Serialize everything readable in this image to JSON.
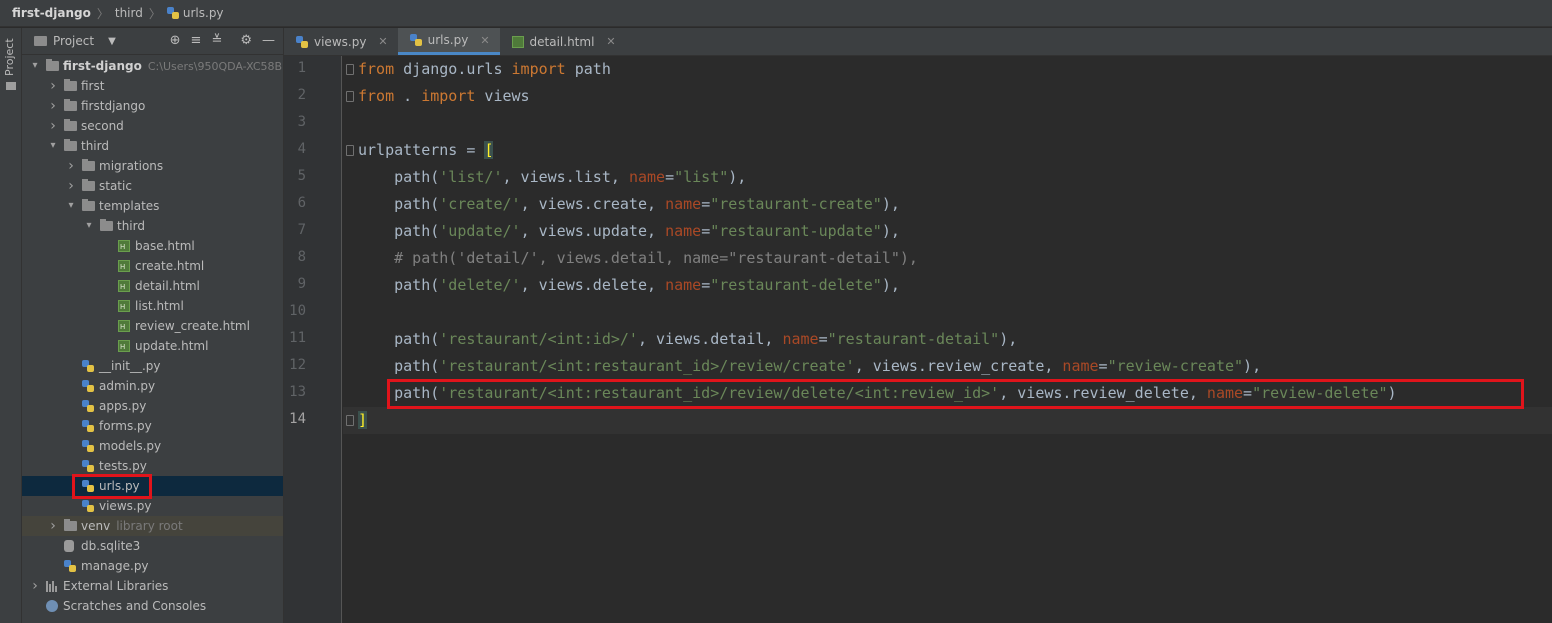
{
  "breadcrumb": {
    "project": "first-django",
    "folder": "third",
    "file": "urls.py"
  },
  "tool_strip": {
    "label": "Project"
  },
  "project_panel": {
    "title": "Project",
    "tree": [
      {
        "label": "first-django",
        "suffix": "C:\\Users\\950QDA-XC58B",
        "type": "folder",
        "depth": 0,
        "expanded": true
      },
      {
        "label": "first",
        "type": "folder",
        "depth": 1,
        "expanded": false
      },
      {
        "label": "firstdjango",
        "type": "folder",
        "depth": 1,
        "expanded": false
      },
      {
        "label": "second",
        "type": "folder",
        "depth": 1,
        "expanded": false
      },
      {
        "label": "third",
        "type": "folder",
        "depth": 1,
        "expanded": true
      },
      {
        "label": "migrations",
        "type": "folder",
        "depth": 2,
        "expanded": false
      },
      {
        "label": "static",
        "type": "folder",
        "depth": 2,
        "expanded": false
      },
      {
        "label": "templates",
        "type": "folder",
        "depth": 2,
        "expanded": true
      },
      {
        "label": "third",
        "type": "folder",
        "depth": 3,
        "expanded": true
      },
      {
        "label": "base.html",
        "type": "html",
        "depth": 4
      },
      {
        "label": "create.html",
        "type": "html",
        "depth": 4
      },
      {
        "label": "detail.html",
        "type": "html",
        "depth": 4
      },
      {
        "label": "list.html",
        "type": "html",
        "depth": 4
      },
      {
        "label": "review_create.html",
        "type": "html",
        "depth": 4
      },
      {
        "label": "update.html",
        "type": "html",
        "depth": 4
      },
      {
        "label": "__init__.py",
        "type": "py",
        "depth": 2
      },
      {
        "label": "admin.py",
        "type": "py",
        "depth": 2
      },
      {
        "label": "apps.py",
        "type": "py",
        "depth": 2
      },
      {
        "label": "forms.py",
        "type": "py",
        "depth": 2
      },
      {
        "label": "models.py",
        "type": "py",
        "depth": 2
      },
      {
        "label": "tests.py",
        "type": "py",
        "depth": 2
      },
      {
        "label": "urls.py",
        "type": "py",
        "depth": 2,
        "selected": true
      },
      {
        "label": "views.py",
        "type": "py",
        "depth": 2
      },
      {
        "label": "venv",
        "suffix": "library root",
        "type": "folder",
        "depth": 1,
        "expanded": false,
        "venv": true
      },
      {
        "label": "db.sqlite3",
        "type": "db",
        "depth": 1
      },
      {
        "label": "manage.py",
        "type": "py",
        "depth": 1
      },
      {
        "label": "External Libraries",
        "type": "lib",
        "depth": 0,
        "expanded": false
      },
      {
        "label": "Scratches and Consoles",
        "type": "scratch",
        "depth": 0
      }
    ]
  },
  "tabs": [
    {
      "label": "views.py",
      "icon": "python-file-icon",
      "active": false
    },
    {
      "label": "urls.py",
      "icon": "python-file-icon",
      "active": true
    },
    {
      "label": "detail.html",
      "icon": "html-file-icon",
      "active": false
    }
  ],
  "editor": {
    "current_line": 14,
    "highlighted_line": 13,
    "lines": [
      [
        [
          "kw",
          "from"
        ],
        [
          "plain",
          " django.urls "
        ],
        [
          "kw",
          "import"
        ],
        [
          "plain",
          " path"
        ]
      ],
      [
        [
          "kw",
          "from"
        ],
        [
          "plain",
          " . "
        ],
        [
          "kw",
          "import"
        ],
        [
          "plain",
          " views"
        ]
      ],
      [],
      [
        [
          "plain",
          "urlpatterns = "
        ],
        [
          "bracket",
          "["
        ]
      ],
      [
        [
          "plain",
          "    path("
        ],
        [
          "str",
          "'list/'"
        ],
        [
          "plain",
          ", views.list, "
        ],
        [
          "kwarg",
          "name"
        ],
        [
          "plain",
          "="
        ],
        [
          "str",
          "\"list\""
        ],
        [
          "plain",
          "),"
        ]
      ],
      [
        [
          "plain",
          "    path("
        ],
        [
          "str",
          "'create/'"
        ],
        [
          "plain",
          ", views.create, "
        ],
        [
          "kwarg",
          "name"
        ],
        [
          "plain",
          "="
        ],
        [
          "str",
          "\"restaurant-create\""
        ],
        [
          "plain",
          "),"
        ]
      ],
      [
        [
          "plain",
          "    path("
        ],
        [
          "str",
          "'update/'"
        ],
        [
          "plain",
          ", views.update, "
        ],
        [
          "kwarg",
          "name"
        ],
        [
          "plain",
          "="
        ],
        [
          "str",
          "\"restaurant-update\""
        ],
        [
          "plain",
          "),"
        ]
      ],
      [
        [
          "cmt",
          "    # path('detail/', views.detail, name=\"restaurant-detail\"),"
        ]
      ],
      [
        [
          "plain",
          "    path("
        ],
        [
          "str",
          "'delete/'"
        ],
        [
          "plain",
          ", views.delete, "
        ],
        [
          "kwarg",
          "name"
        ],
        [
          "plain",
          "="
        ],
        [
          "str",
          "\"restaurant-delete\""
        ],
        [
          "plain",
          "),"
        ]
      ],
      [],
      [
        [
          "plain",
          "    path("
        ],
        [
          "str",
          "'restaurant/<int:id>/'"
        ],
        [
          "plain",
          ", views.detail, "
        ],
        [
          "kwarg",
          "name"
        ],
        [
          "plain",
          "="
        ],
        [
          "str",
          "\"restaurant-detail\""
        ],
        [
          "plain",
          "),"
        ]
      ],
      [
        [
          "plain",
          "    path("
        ],
        [
          "str",
          "'restaurant/<int:restaurant_id>/review/create'"
        ],
        [
          "plain",
          ", views.review_create, "
        ],
        [
          "kwarg",
          "name"
        ],
        [
          "plain",
          "="
        ],
        [
          "str",
          "\"review-create\""
        ],
        [
          "plain",
          "),"
        ]
      ],
      [
        [
          "plain",
          "    path("
        ],
        [
          "str",
          "'restaurant/<int:restaurant_id>/review/delete/<int:review_id>'"
        ],
        [
          "plain",
          ", views.review_delete, "
        ],
        [
          "kwarg",
          "name"
        ],
        [
          "plain",
          "="
        ],
        [
          "str",
          "\"review-delete\""
        ],
        [
          "plain",
          ")"
        ]
      ],
      [
        [
          "bracket",
          "]"
        ]
      ]
    ]
  },
  "colors": {
    "keyword": "#cc7832",
    "string": "#6a8759",
    "comment": "#808080",
    "kwarg": "#aa4926",
    "plain": "#a9b7c6",
    "highlight_box": "#e0141b",
    "selection": "#0d293e"
  }
}
